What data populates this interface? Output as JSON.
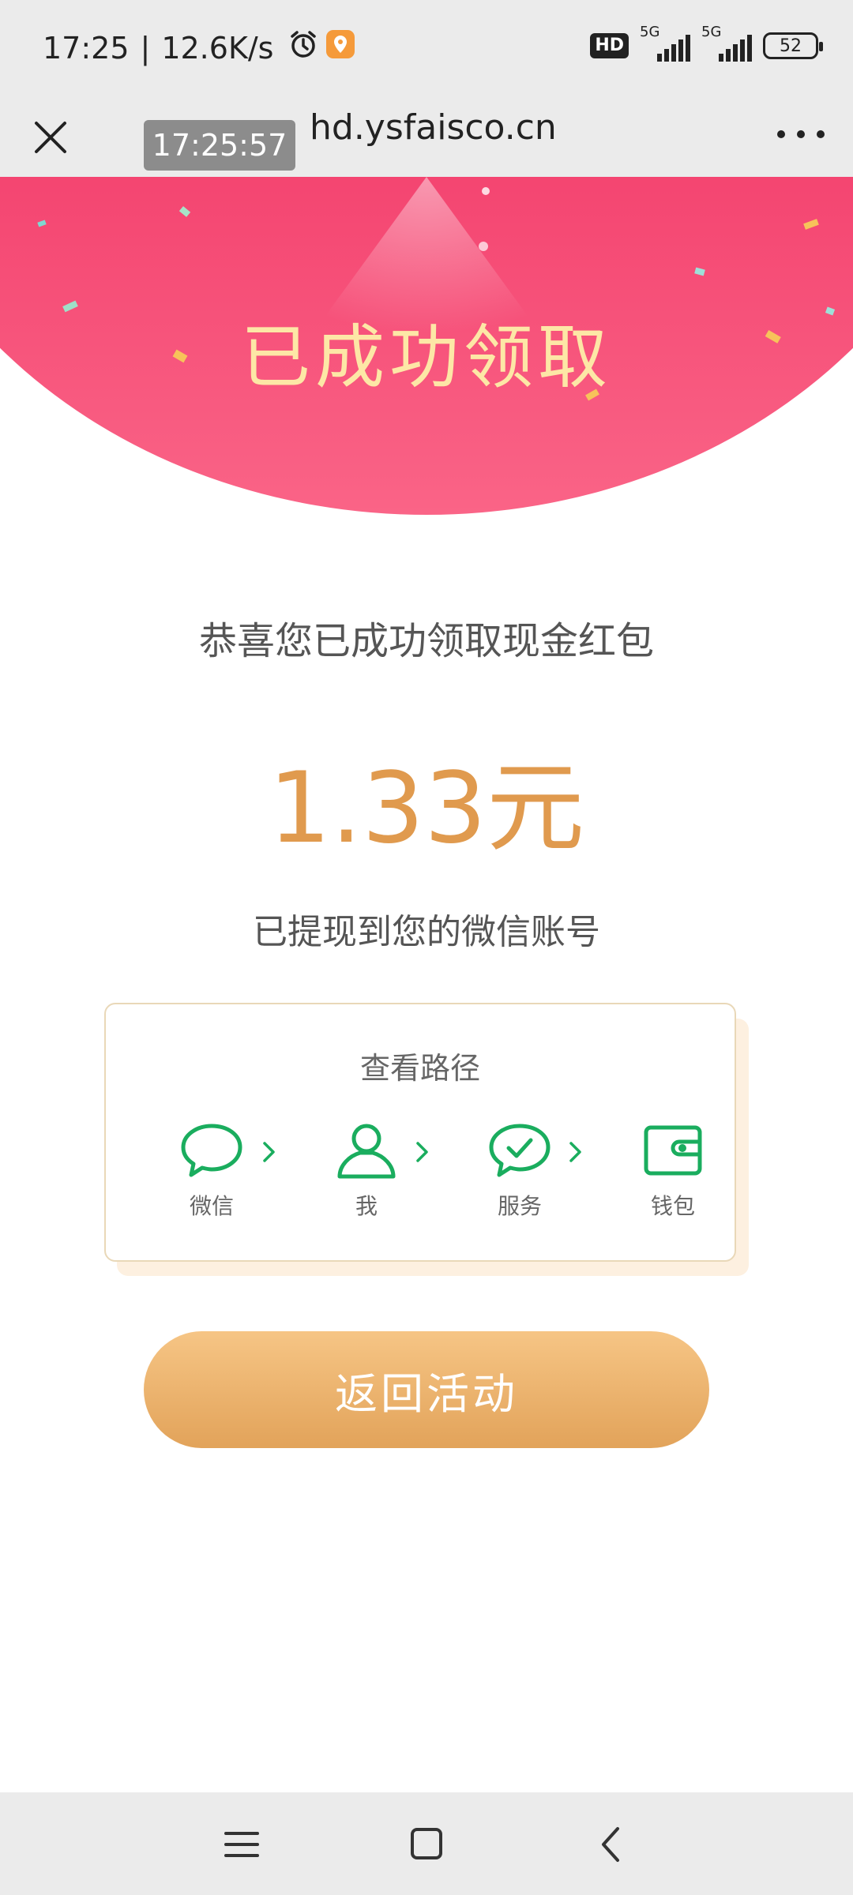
{
  "status_bar": {
    "time": "17:25",
    "separator": "|",
    "net_speed": "12.6K/s",
    "icons": [
      "alarm-icon",
      "location-app-icon"
    ],
    "hd_badge": "HD",
    "signal_1_label": "5G",
    "signal_2_label": "5G",
    "battery": "52"
  },
  "browser": {
    "url": "hd.ysfaisco.cn",
    "time_overlay": "17:25:57",
    "close_icon": "close-icon",
    "more_icon": "more-dots-icon"
  },
  "banner": {
    "title": "已成功领取",
    "colors": {
      "top": "#f3406d",
      "bottom": "#fa6487",
      "title": "#fde7a6"
    }
  },
  "result": {
    "congrats": "恭喜您已成功领取现金红包",
    "amount": "1.33元",
    "withdrawn_note": "已提现到您的微信账号",
    "amount_color": "#e09a4e"
  },
  "path_card": {
    "title": "查看路径",
    "steps": [
      {
        "label": "微信",
        "icon": "wechat-chat-icon"
      },
      {
        "label": "我",
        "icon": "person-icon"
      },
      {
        "label": "服务",
        "icon": "service-check-icon"
      },
      {
        "label": "钱包",
        "icon": "wallet-icon"
      }
    ],
    "icon_color": "#1aad5e"
  },
  "actions": {
    "return_label": "返回活动"
  },
  "nav_bar": {
    "buttons": [
      "menu-icon",
      "home-square-icon",
      "back-chevron-icon"
    ]
  }
}
